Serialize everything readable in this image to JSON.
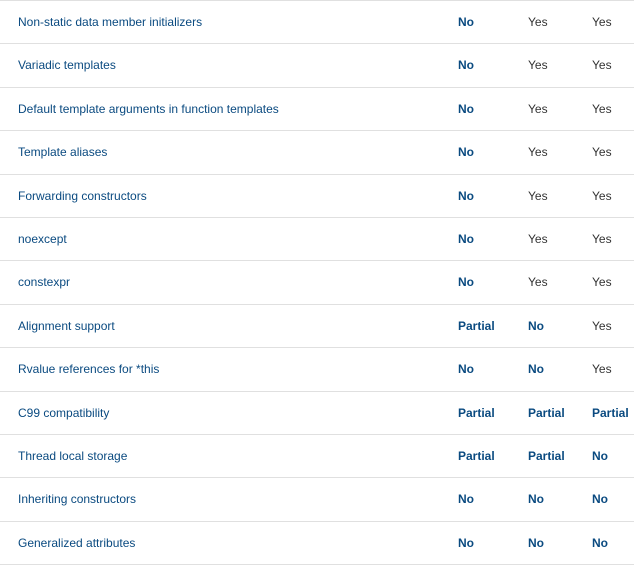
{
  "rows": [
    {
      "feature": "Non-static data member initializers",
      "a": {
        "text": "No",
        "link": true
      },
      "b": {
        "text": "Yes",
        "link": false
      },
      "c": {
        "text": "Yes",
        "link": false
      }
    },
    {
      "feature": "Variadic templates",
      "a": {
        "text": "No",
        "link": true
      },
      "b": {
        "text": "Yes",
        "link": false
      },
      "c": {
        "text": "Yes",
        "link": false
      }
    },
    {
      "feature": "Default template arguments in function templates",
      "a": {
        "text": "No",
        "link": true
      },
      "b": {
        "text": "Yes",
        "link": false
      },
      "c": {
        "text": "Yes",
        "link": false
      }
    },
    {
      "feature": "Template aliases",
      "a": {
        "text": "No",
        "link": true
      },
      "b": {
        "text": "Yes",
        "link": false
      },
      "c": {
        "text": "Yes",
        "link": false
      }
    },
    {
      "feature": "Forwarding constructors",
      "a": {
        "text": "No",
        "link": true
      },
      "b": {
        "text": "Yes",
        "link": false
      },
      "c": {
        "text": "Yes",
        "link": false
      }
    },
    {
      "feature": "noexcept",
      "a": {
        "text": "No",
        "link": true
      },
      "b": {
        "text": "Yes",
        "link": false
      },
      "c": {
        "text": "Yes",
        "link": false
      }
    },
    {
      "feature": "constexpr",
      "a": {
        "text": "No",
        "link": true
      },
      "b": {
        "text": "Yes",
        "link": false
      },
      "c": {
        "text": "Yes",
        "link": false
      }
    },
    {
      "feature": "Alignment support",
      "a": {
        "text": "Partial",
        "link": true
      },
      "b": {
        "text": "No",
        "link": true
      },
      "c": {
        "text": "Yes",
        "link": false
      }
    },
    {
      "feature": "Rvalue references for *this",
      "a": {
        "text": "No",
        "link": true
      },
      "b": {
        "text": "No",
        "link": true
      },
      "c": {
        "text": "Yes",
        "link": false
      }
    },
    {
      "feature": "C99 compatibility",
      "a": {
        "text": "Partial",
        "link": true
      },
      "b": {
        "text": "Partial",
        "link": true
      },
      "c": {
        "text": "Partial",
        "link": true
      }
    },
    {
      "feature": "Thread local storage",
      "a": {
        "text": "Partial",
        "link": true
      },
      "b": {
        "text": "Partial",
        "link": true
      },
      "c": {
        "text": "No",
        "link": true
      }
    },
    {
      "feature": "Inheriting constructors",
      "a": {
        "text": "No",
        "link": true
      },
      "b": {
        "text": "No",
        "link": true
      },
      "c": {
        "text": "No",
        "link": true
      }
    },
    {
      "feature": "Generalized attributes",
      "a": {
        "text": "No",
        "link": true
      },
      "b": {
        "text": "No",
        "link": true
      },
      "c": {
        "text": "No",
        "link": true
      }
    }
  ]
}
